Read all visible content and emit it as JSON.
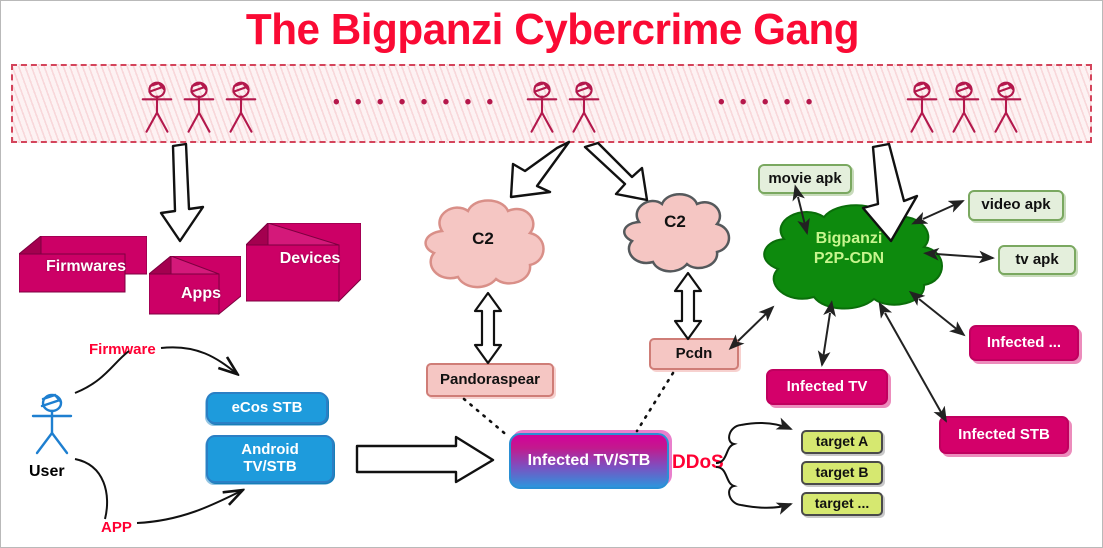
{
  "title": "The Bigpanzi Cybercrime Gang",
  "banner": {
    "name": "gang-members-banner",
    "dots_1": "• • • • • • • •",
    "dots_2": "• • • • •",
    "group_counts": [
      3,
      2,
      3
    ]
  },
  "assets": {
    "firmwares": "Firmwares",
    "apps": "Apps",
    "devices": "Devices"
  },
  "user": {
    "label": "User",
    "firmware_path_label": "Firmware",
    "app_path_label": "APP"
  },
  "devices": {
    "ecos_stb": "eCos STB",
    "android_tv_stb": "Android\nTV/STB",
    "android_tv_stb_line1": "Android",
    "android_tv_stb_line2": "TV/STB"
  },
  "c2": {
    "left_label": "C2",
    "right_label": "C2"
  },
  "malware": {
    "pandoraspear": "Pandoraspear",
    "pcdn": "Pcdn"
  },
  "infected": {
    "tv_stb": "Infected TV/STB",
    "tv": "Infected TV",
    "ellipsis": "Infected ...",
    "stb": "Infected STB"
  },
  "cdn": {
    "line1": "Bigpanzi",
    "line2": "P2P-CDN"
  },
  "apks": {
    "movie": "movie apk",
    "video": "video apk",
    "tv": "tv apk"
  },
  "ddos": {
    "label": "DDoS",
    "targets": [
      "target A",
      "target B",
      "target ..."
    ]
  },
  "colors": {
    "title_red": "#FA0A34",
    "magenta": "#CC0066",
    "blue": "#1E9BDC",
    "green_cloud": "#0D8A0D",
    "pink_cloud": "#F5C6C3",
    "target_green": "#D6E870",
    "apk_green": "#E4EFDC",
    "accent_red": "#FF0033"
  }
}
